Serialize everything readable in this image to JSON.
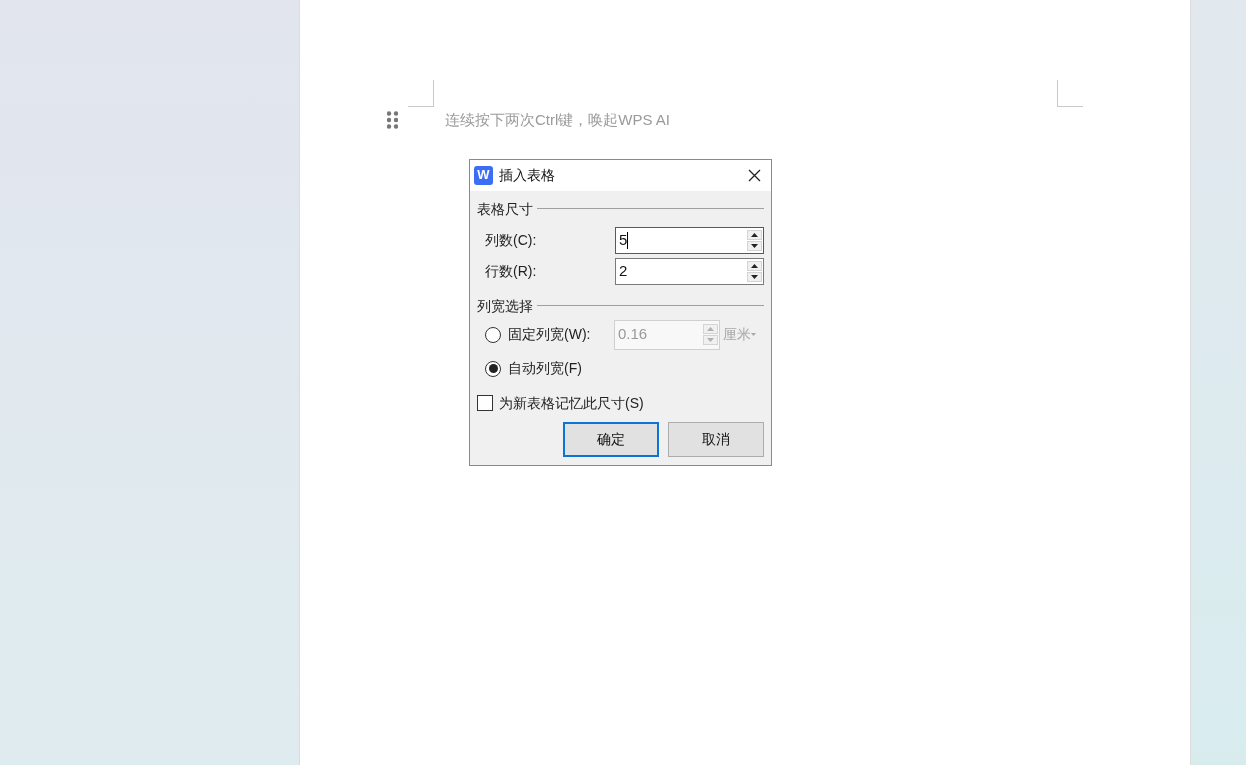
{
  "editor": {
    "ai_hint": "连续按下两次Ctrl键，唤起WPS AI"
  },
  "dialog": {
    "app_icon": "W",
    "title": "插入表格",
    "size_section": {
      "title": "表格尺寸",
      "fields": [
        {
          "label": "列数(C):",
          "value": "5",
          "focused": true
        },
        {
          "label": "行数(R):",
          "value": "2",
          "focused": false
        }
      ]
    },
    "width_section": {
      "title": "列宽选择",
      "options": [
        {
          "kind": "spin",
          "label": "固定列宽(W):",
          "selected": false,
          "value": "0.16",
          "unit": "厘米",
          "disabled": true
        },
        {
          "kind": "plain",
          "label": "自动列宽(F)",
          "selected": true
        }
      ]
    },
    "remember": {
      "label": "为新表格记忆此尺寸(S)",
      "checked": false
    },
    "buttons": [
      {
        "label": "确定",
        "default": true
      },
      {
        "label": "取消",
        "default": false
      }
    ]
  }
}
